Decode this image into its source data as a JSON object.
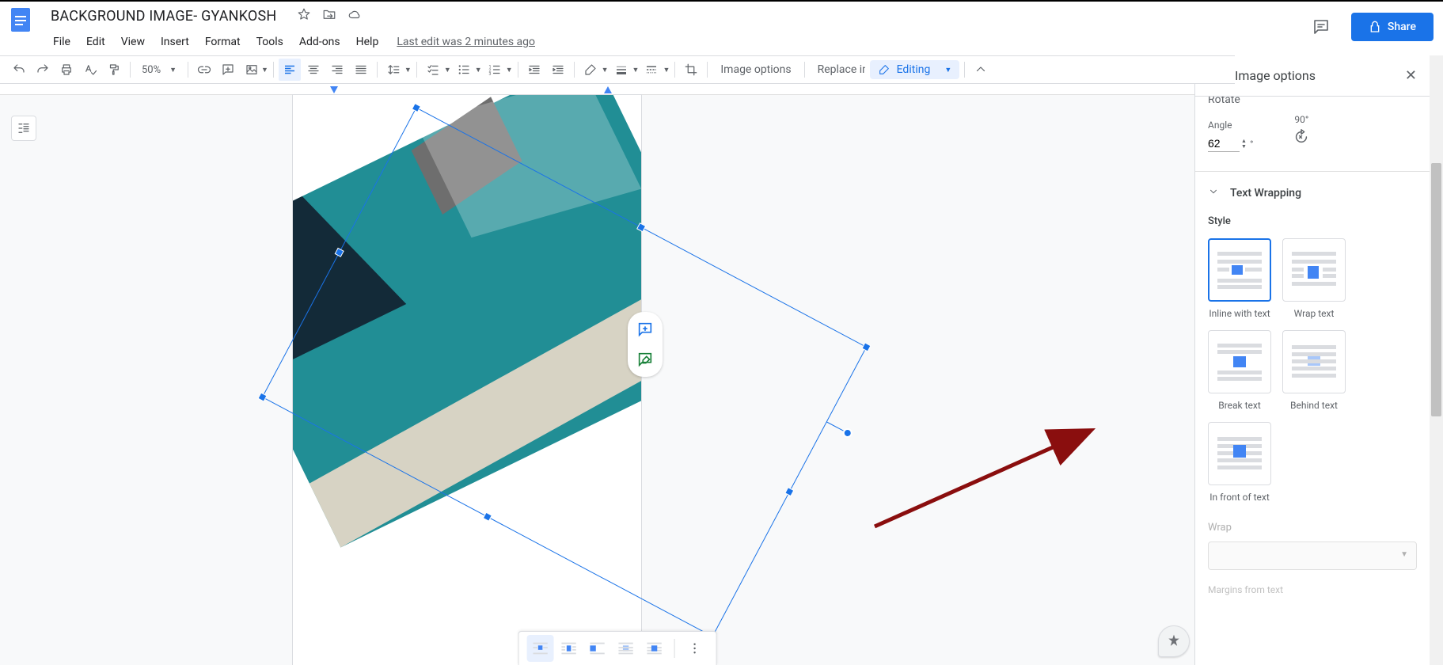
{
  "doc": {
    "title": "BACKGROUND IMAGE- GYANKOSH",
    "lastedit": "Last edit was 2 minutes ago"
  },
  "menu": {
    "file": "File",
    "edit": "Edit",
    "view": "View",
    "insert": "Insert",
    "format": "Format",
    "tools": "Tools",
    "addons": "Add-ons",
    "help": "Help"
  },
  "share": {
    "label": "Share"
  },
  "toolbar": {
    "zoom": "50%",
    "imageoptions": "Image options",
    "replace": "Replace image",
    "mode": "Editing"
  },
  "sidebar": {
    "title": "Image options",
    "rotate_partial": "Rotate",
    "angle_label": "Angle",
    "angle_value": "62",
    "deg90_label": "90°",
    "textwrap_title": "Text Wrapping",
    "style_label": "Style",
    "wrap_label": "Wrap",
    "margins_label": "Margins from text",
    "opts": {
      "inline": "Inline with text",
      "wrap": "Wrap text",
      "break": "Break text",
      "behind": "Behind text",
      "front": "In front of text"
    }
  }
}
